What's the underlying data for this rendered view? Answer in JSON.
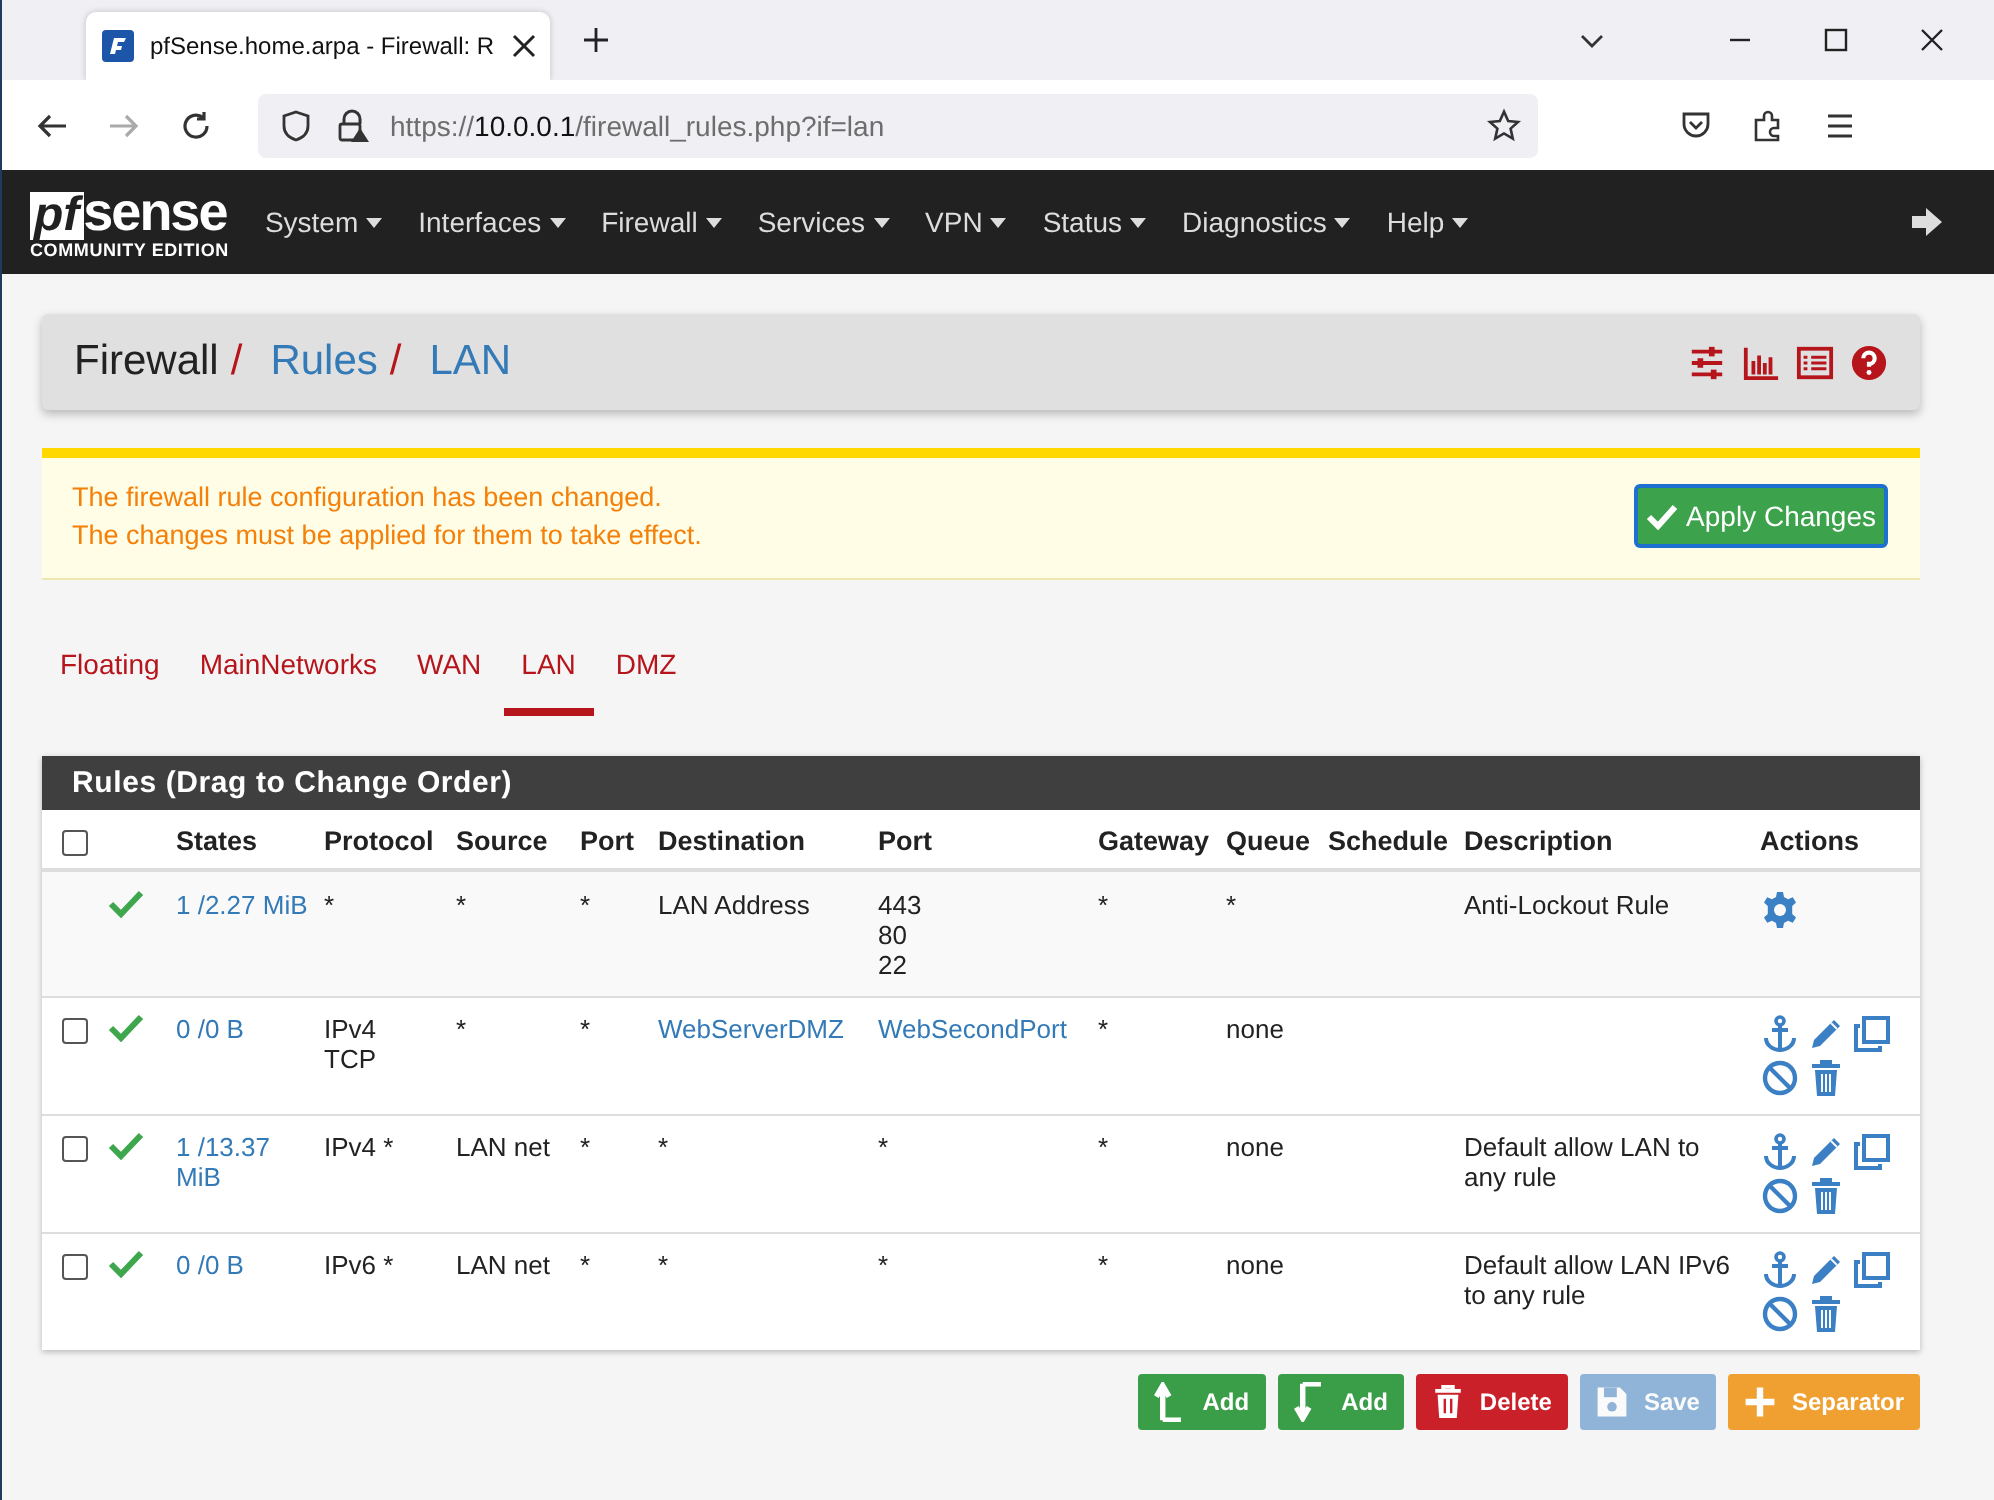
{
  "browser": {
    "tab_title": "pfSense.home.arpa - Firewall: R",
    "url": {
      "scheme": "https://",
      "host": "10.0.0.1",
      "path": "/firewall_rules.php?if=lan"
    }
  },
  "navbar": {
    "logo": {
      "mark": "pf",
      "word": "sense",
      "edition": "COMMUNITY EDITION"
    },
    "menus": [
      "System",
      "Interfaces",
      "Firewall",
      "Services",
      "VPN",
      "Status",
      "Diagnostics",
      "Help"
    ]
  },
  "breadcrumb": {
    "separator": "/",
    "items": [
      {
        "label": "Firewall",
        "link": false
      },
      {
        "label": "Rules",
        "link": true
      },
      {
        "label": "LAN",
        "link": true
      }
    ]
  },
  "alert": {
    "lines": [
      "The firewall rule configuration has been changed.",
      "The changes must be applied for them to take effect."
    ],
    "button": "Apply Changes"
  },
  "tabs": [
    {
      "label": "Floating",
      "selected": false
    },
    {
      "label": "MainNetworks",
      "selected": false
    },
    {
      "label": "WAN",
      "selected": false
    },
    {
      "label": "LAN",
      "selected": true
    },
    {
      "label": "DMZ",
      "selected": false
    }
  ],
  "table": {
    "title": "Rules (Drag to Change Order)",
    "select_all_checked": false,
    "columns": [
      "States",
      "Protocol",
      "Source",
      "Port",
      "Destination",
      "Port",
      "Gateway",
      "Queue",
      "Schedule",
      "Description",
      "Actions"
    ],
    "rows": [
      {
        "kind": "fixed",
        "states": "1 /2.27 MiB",
        "protocol": "*",
        "source": "*",
        "source_port": "*",
        "destination": {
          "text": "LAN Address",
          "link": false
        },
        "destination_port": {
          "text": "443\n80\n22",
          "link": false
        },
        "gateway": "*",
        "queue": "*",
        "schedule": "",
        "description": "Anti-Lockout Rule"
      },
      {
        "kind": "rule",
        "checked": false,
        "states": "0 /0 B",
        "protocol": "IPv4\nTCP",
        "source": "*",
        "source_port": "*",
        "destination": {
          "text": "WebServerDMZ",
          "link": true
        },
        "destination_port": {
          "text": "WebSecondPort",
          "link": true
        },
        "gateway": "*",
        "queue": "none",
        "schedule": "",
        "description": ""
      },
      {
        "kind": "rule",
        "checked": false,
        "states": "1 /13.37 MiB",
        "protocol": "IPv4 *",
        "source": "LAN net",
        "source_port": "*",
        "destination": {
          "text": "*",
          "link": false
        },
        "destination_port": {
          "text": "*",
          "link": false
        },
        "gateway": "*",
        "queue": "none",
        "schedule": "",
        "description": "Default allow LAN to any rule"
      },
      {
        "kind": "rule",
        "checked": false,
        "states": "0 /0 B",
        "protocol": "IPv6 *",
        "source": "LAN net",
        "source_port": "*",
        "destination": {
          "text": "*",
          "link": false
        },
        "destination_port": {
          "text": "*",
          "link": false
        },
        "gateway": "*",
        "queue": "none",
        "schedule": "",
        "description": "Default allow LAN IPv6 to any rule"
      }
    ]
  },
  "buttons": [
    {
      "kind": "add-top",
      "label": "Add",
      "disabled": false
    },
    {
      "kind": "add-bottom",
      "label": "Add",
      "disabled": false
    },
    {
      "kind": "delete",
      "label": "Delete",
      "disabled": false
    },
    {
      "kind": "save",
      "label": "Save",
      "disabled": true
    },
    {
      "kind": "separator",
      "label": "Separator",
      "disabled": false
    }
  ]
}
